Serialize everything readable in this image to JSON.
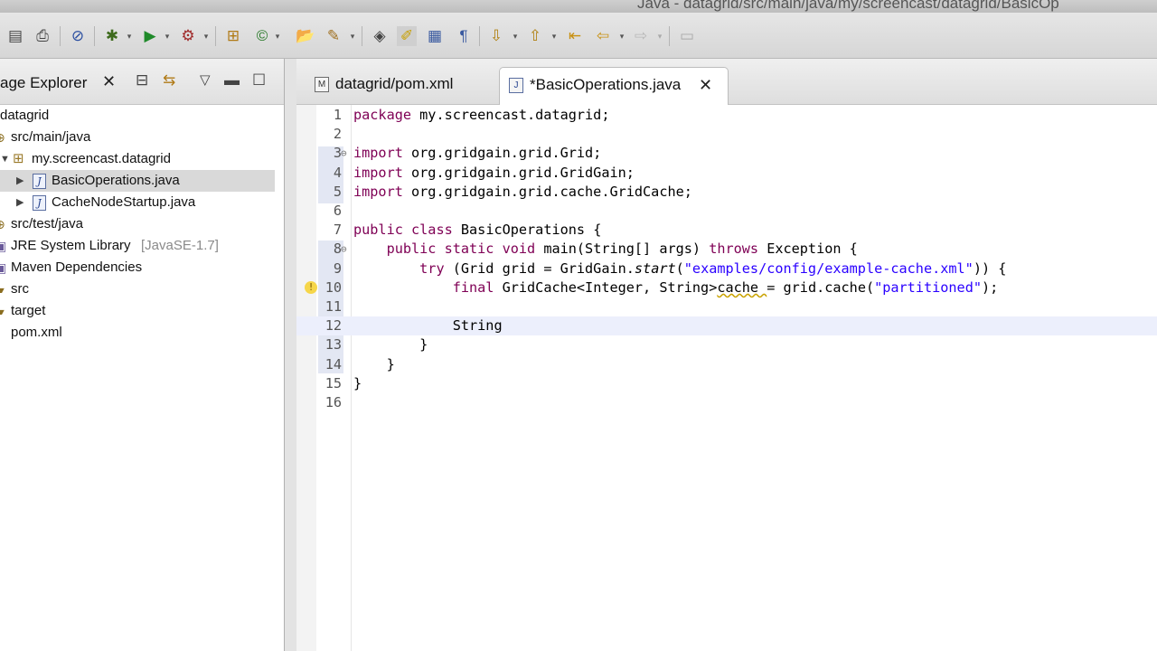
{
  "window": {
    "title": "Java - datagrid/src/main/java/my/screencast/datagrid/BasicOp"
  },
  "toolbar": {
    "icons": [
      "save-all-icon",
      "print-icon",
      "skip-breakpoints-icon",
      "debug-icon",
      "run-icon",
      "external-tools-icon",
      "new-java-package-icon",
      "new-java-class-icon",
      "open-type-icon",
      "search-icon",
      "toggle-mark-occurrences-icon",
      "highlight-icon",
      "show-whitespace-icon",
      "paragraph-icon",
      "next-annotation-icon",
      "previous-annotation-icon",
      "last-edit-location-icon",
      "back-icon",
      "forward-icon",
      "pin-editor-icon"
    ]
  },
  "explorer": {
    "title": "age Explorer",
    "close_glyph": "✕",
    "items": [
      {
        "label": "datagrid",
        "extra": ""
      },
      {
        "label": "src/main/java",
        "extra": ""
      },
      {
        "label": "my.screencast.datagrid",
        "extra": ""
      },
      {
        "label": "BasicOperations.java",
        "extra": ""
      },
      {
        "label": "CacheNodeStartup.java",
        "extra": ""
      },
      {
        "label": "src/test/java",
        "extra": ""
      },
      {
        "label": "JRE System Library",
        "extra": "[JavaSE-1.7]"
      },
      {
        "label": "Maven Dependencies",
        "extra": ""
      },
      {
        "label": "src",
        "extra": ""
      },
      {
        "label": "target",
        "extra": ""
      },
      {
        "label": "pom.xml",
        "extra": ""
      }
    ]
  },
  "editor": {
    "tabs": [
      {
        "label": "datagrid/pom.xml",
        "icon_text": "M"
      },
      {
        "label": "*BasicOperations.java",
        "icon_text": "J",
        "close_glyph": "✕"
      }
    ],
    "lines": [
      {
        "n": "1",
        "parts": [
          [
            "kw",
            "package"
          ],
          [
            "",
            "my.screencast.datagrid;"
          ]
        ]
      },
      {
        "n": "2",
        "parts": []
      },
      {
        "n": "3",
        "parts": [
          [
            "kw",
            "import"
          ],
          [
            "",
            "org.gridgain.grid.Grid;"
          ]
        ]
      },
      {
        "n": "4",
        "parts": [
          [
            "kw",
            "import"
          ],
          [
            "",
            "org.gridgain.grid.GridGain;"
          ]
        ]
      },
      {
        "n": "5",
        "parts": [
          [
            "kw",
            "import"
          ],
          [
            "",
            "org.gridgain.grid.cache.GridCache;"
          ]
        ]
      },
      {
        "n": "6",
        "parts": []
      },
      {
        "n": "7",
        "parts": [
          [
            "kw",
            "public"
          ],
          [
            "kw",
            "class"
          ],
          [
            "",
            "BasicOperations {"
          ]
        ]
      },
      {
        "n": "8",
        "parts": [
          [
            "",
            "    "
          ],
          [
            "kw",
            "public"
          ],
          [
            "kw",
            "static"
          ],
          [
            "kw",
            "void"
          ],
          [
            "",
            "main(String[] args)"
          ],
          [
            "kw",
            "throws"
          ],
          [
            "",
            "Exception {"
          ]
        ]
      },
      {
        "n": "9",
        "parts": [
          [
            "",
            "        "
          ],
          [
            "kw",
            "try"
          ],
          [
            "",
            "(Grid grid = GridGain."
          ],
          [
            "ital",
            "start"
          ],
          [
            "",
            "("
          ],
          [
            "str",
            "\"examples/config/example-cache.xml\""
          ],
          [
            "",
            ")) {"
          ]
        ]
      },
      {
        "n": "10",
        "parts": [
          [
            "",
            "            "
          ],
          [
            "kw",
            "final"
          ],
          [
            "",
            "GridCache<Integer, String>"
          ],
          [
            "warn",
            "cache"
          ],
          [
            "",
            "= grid.cache("
          ],
          [
            "str",
            "\"partitioned\""
          ],
          [
            "",
            ");"
          ]
        ]
      },
      {
        "n": "11",
        "parts": []
      },
      {
        "n": "12",
        "parts": [
          [
            "",
            "            String"
          ]
        ]
      },
      {
        "n": "13",
        "parts": [
          [
            "",
            "        }"
          ]
        ]
      },
      {
        "n": "14",
        "parts": [
          [
            "",
            "    }"
          ]
        ]
      },
      {
        "n": "15",
        "parts": [
          [
            "",
            "}"
          ]
        ]
      },
      {
        "n": "16",
        "parts": []
      }
    ]
  }
}
